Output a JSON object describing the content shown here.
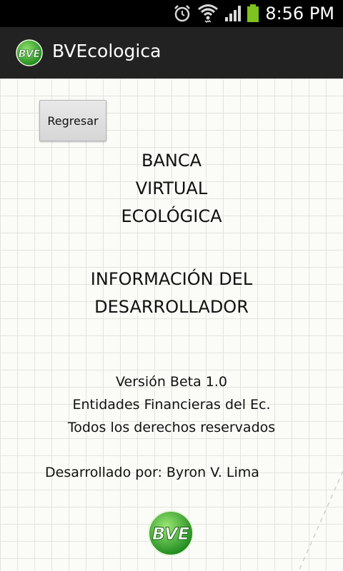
{
  "status_bar": {
    "time": "8:56 PM",
    "icons": [
      "alarm-icon",
      "wifi-icon",
      "signal-icon",
      "battery-icon"
    ]
  },
  "action_bar": {
    "title": "BVEcologica",
    "logo_text": "BVE"
  },
  "content": {
    "back_button_label": "Regresar",
    "title_lines": [
      "BANCA",
      "VIRTUAL",
      "ECOLÓGICA"
    ],
    "subtitle_lines": [
      "INFORMACIÓN DEL",
      "DESARROLLADOR"
    ],
    "info_lines": [
      "Versión Beta 1.0",
      "Entidades Financieras del Ec.",
      "Todos los derechos reservados"
    ],
    "developer": "Desarrollado por: Byron V. Lima",
    "logo_text": "BVE"
  },
  "colors": {
    "action_bar": "#222222",
    "status_bar": "#000000",
    "battery": "#7dc21e",
    "logo_green": "#3aa52a"
  }
}
